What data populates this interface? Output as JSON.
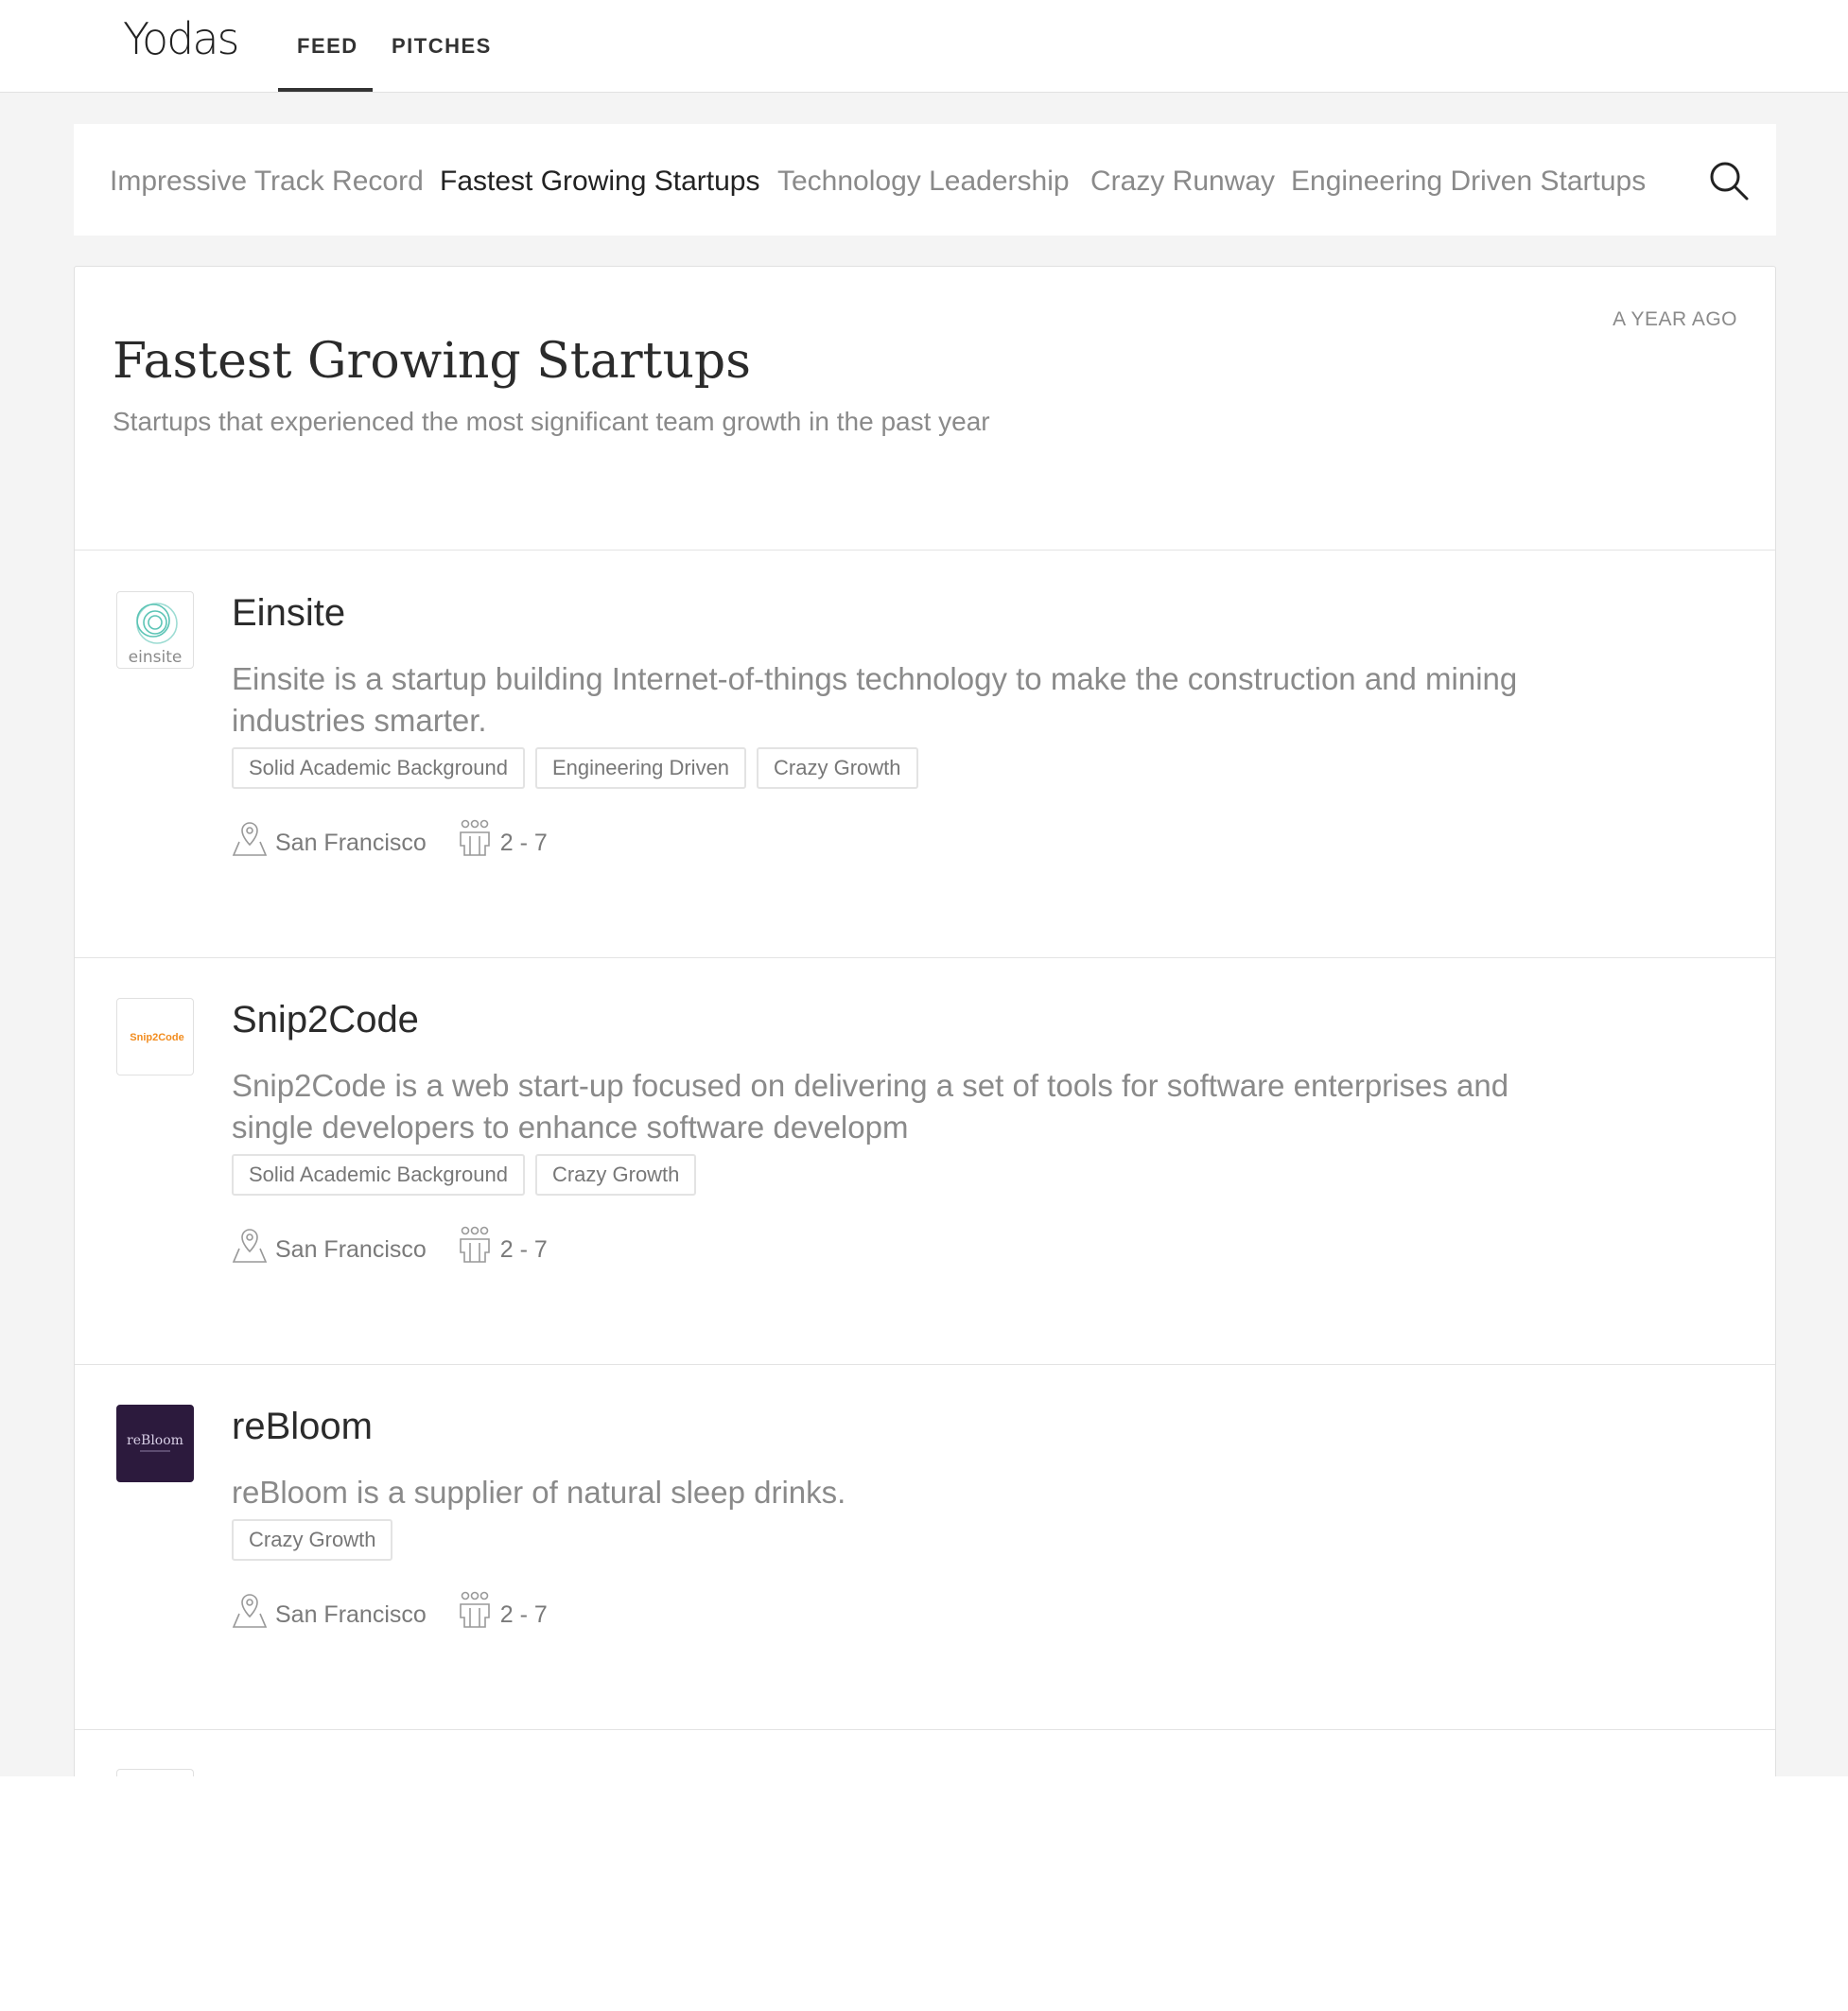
{
  "header": {
    "logo_text": "Yodas",
    "tabs": [
      {
        "label": "FEED",
        "active": true
      },
      {
        "label": "PITCHES",
        "active": false
      }
    ]
  },
  "categories": {
    "items": [
      {
        "label": "Impressive Track Record",
        "active": false
      },
      {
        "label": "Fastest Growing Startups",
        "active": true
      },
      {
        "label": "Technology Leadership",
        "active": false
      },
      {
        "label": "Crazy Runway",
        "active": false
      },
      {
        "label": "Engineering Driven Startups",
        "active": false
      }
    ],
    "search_icon": "search-icon"
  },
  "feed": {
    "time": "A YEAR AGO",
    "title": "Fastest Growing Startups",
    "subtitle": "Startups that experienced the most significant team growth in the past year",
    "companies": [
      {
        "name": "Einsite",
        "logo_text": "einsite",
        "description": "Einsite is a startup building Internet-of-things technology to make the construction and mining industries smarter.",
        "tags": [
          "Solid Academic Background",
          "Engineering Driven",
          "Crazy Growth"
        ],
        "location": "San Francisco",
        "team_size": "2 - 7"
      },
      {
        "name": "Snip2Code",
        "logo_text": "Snip2Code",
        "description": "Snip2Code is a web start-up focused on delivering a set of tools for software enterprises and single developers to enhance software developm",
        "tags": [
          "Solid Academic Background",
          "Crazy Growth"
        ],
        "location": "San Francisco",
        "team_size": "2 - 7"
      },
      {
        "name": "reBloom",
        "logo_text": "reBloom",
        "description": "reBloom is a supplier of natural sleep drinks.",
        "tags": [
          "Crazy Growth"
        ],
        "location": "San Francisco",
        "team_size": "2 - 7"
      }
    ]
  },
  "colors": {
    "page_background": "#f4f4f4",
    "text_dark": "#2b2b2b",
    "text_muted": "#8a8a8a",
    "rebloom_logo_bg": "#2c1a3d",
    "einsite_logo": "#5cc4b5",
    "snip2code_logo": "#f28c1e"
  }
}
